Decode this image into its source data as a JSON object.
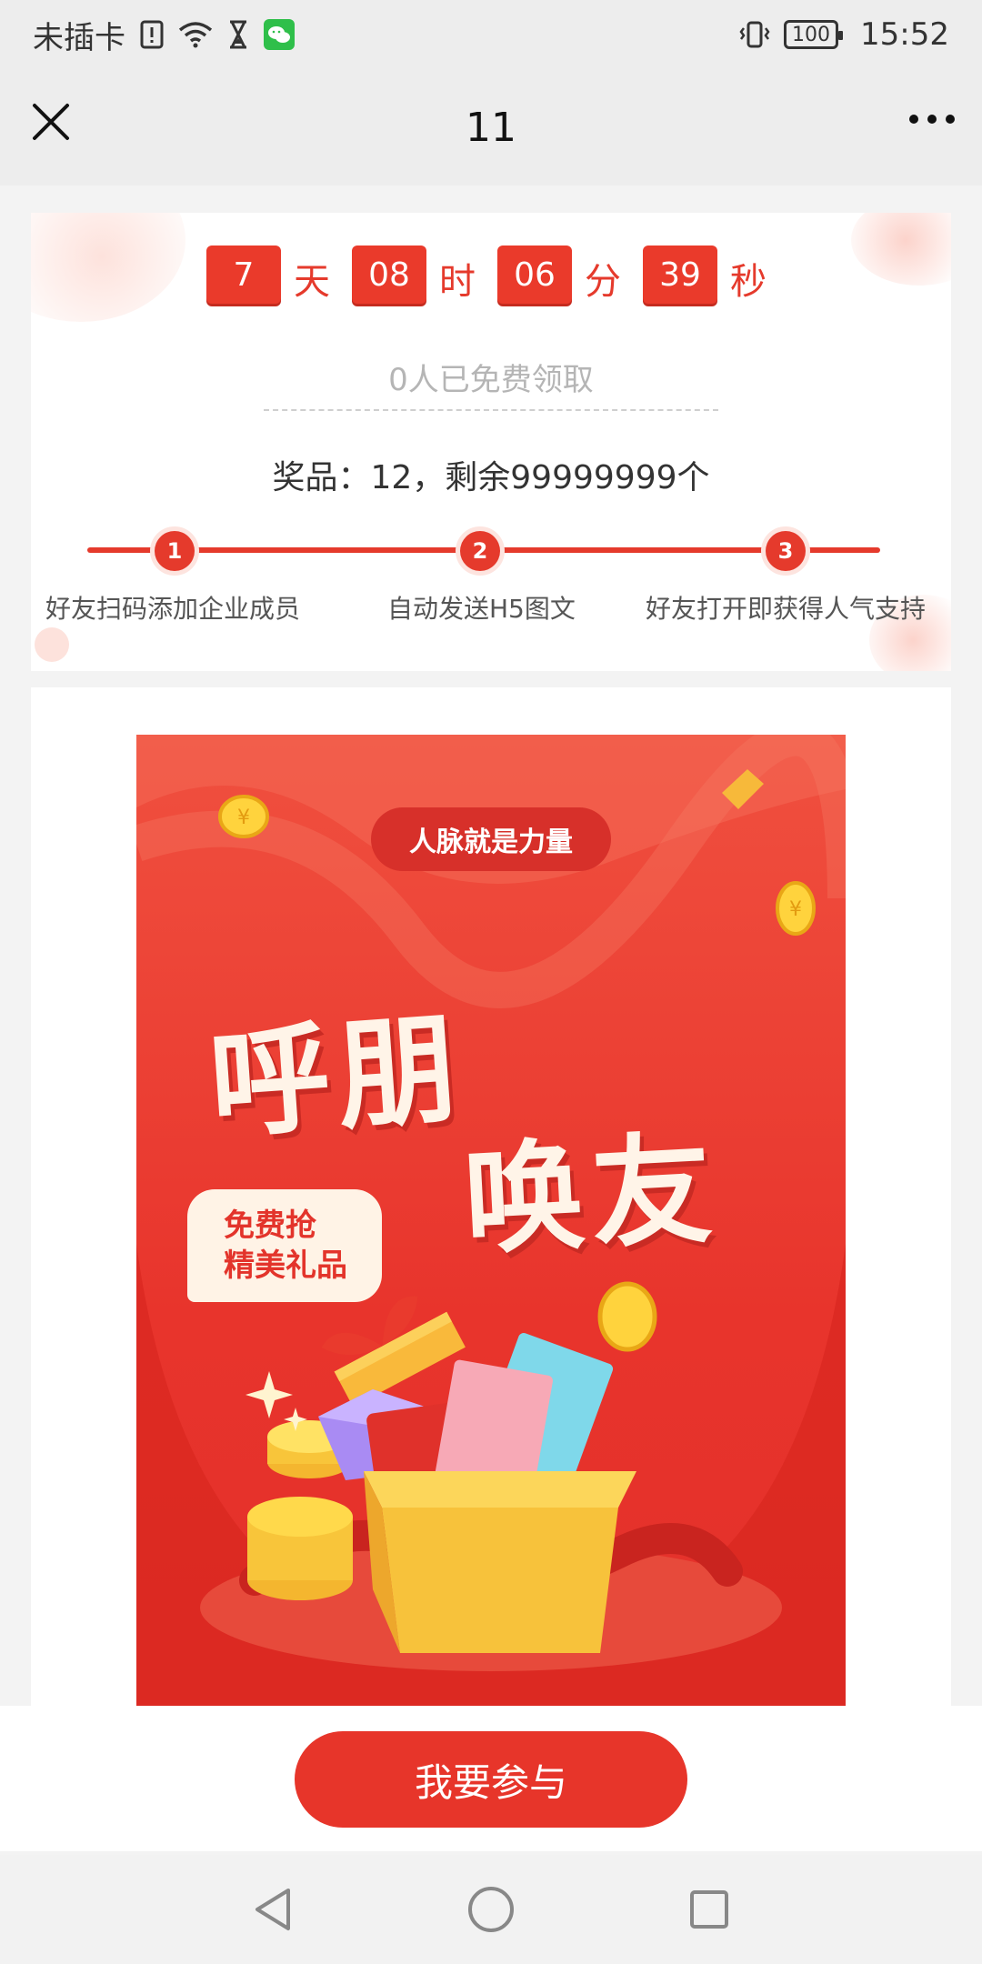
{
  "status_bar": {
    "carrier": "未插卡",
    "battery": "100",
    "time": "15:52",
    "icons": [
      "sim-alert-icon",
      "wifi-icon",
      "hourglass-icon",
      "wechat-app-icon",
      "vibrate-icon",
      "battery-icon"
    ]
  },
  "nav": {
    "title": "11",
    "close_icon": "close-icon",
    "more_icon": "more-icon"
  },
  "countdown": {
    "days": "7",
    "days_unit": "天",
    "hours": "08",
    "hours_unit": "时",
    "minutes": "06",
    "minutes_unit": "分",
    "seconds": "39",
    "seconds_unit": "秒"
  },
  "claimed_text": "0人已免费领取",
  "prize_text": "奖品：12，剩余99999999个",
  "steps": [
    {
      "number": "1",
      "label": "好友扫码添加企业成员"
    },
    {
      "number": "2",
      "label": "自动发送H5图文"
    },
    {
      "number": "3",
      "label": "好友打开即获得人气支持"
    }
  ],
  "poster": {
    "tag": "人脉就是力量",
    "title_line1": "呼朋",
    "title_line2": "唤友",
    "bubble_line1": "免费抢",
    "bubble_line2": "精美礼品"
  },
  "join_button": "我要参与",
  "colors": {
    "accent": "#e7352a",
    "background": "#f3f3f3"
  },
  "android_nav": [
    "back-icon",
    "home-icon",
    "recents-icon"
  ]
}
